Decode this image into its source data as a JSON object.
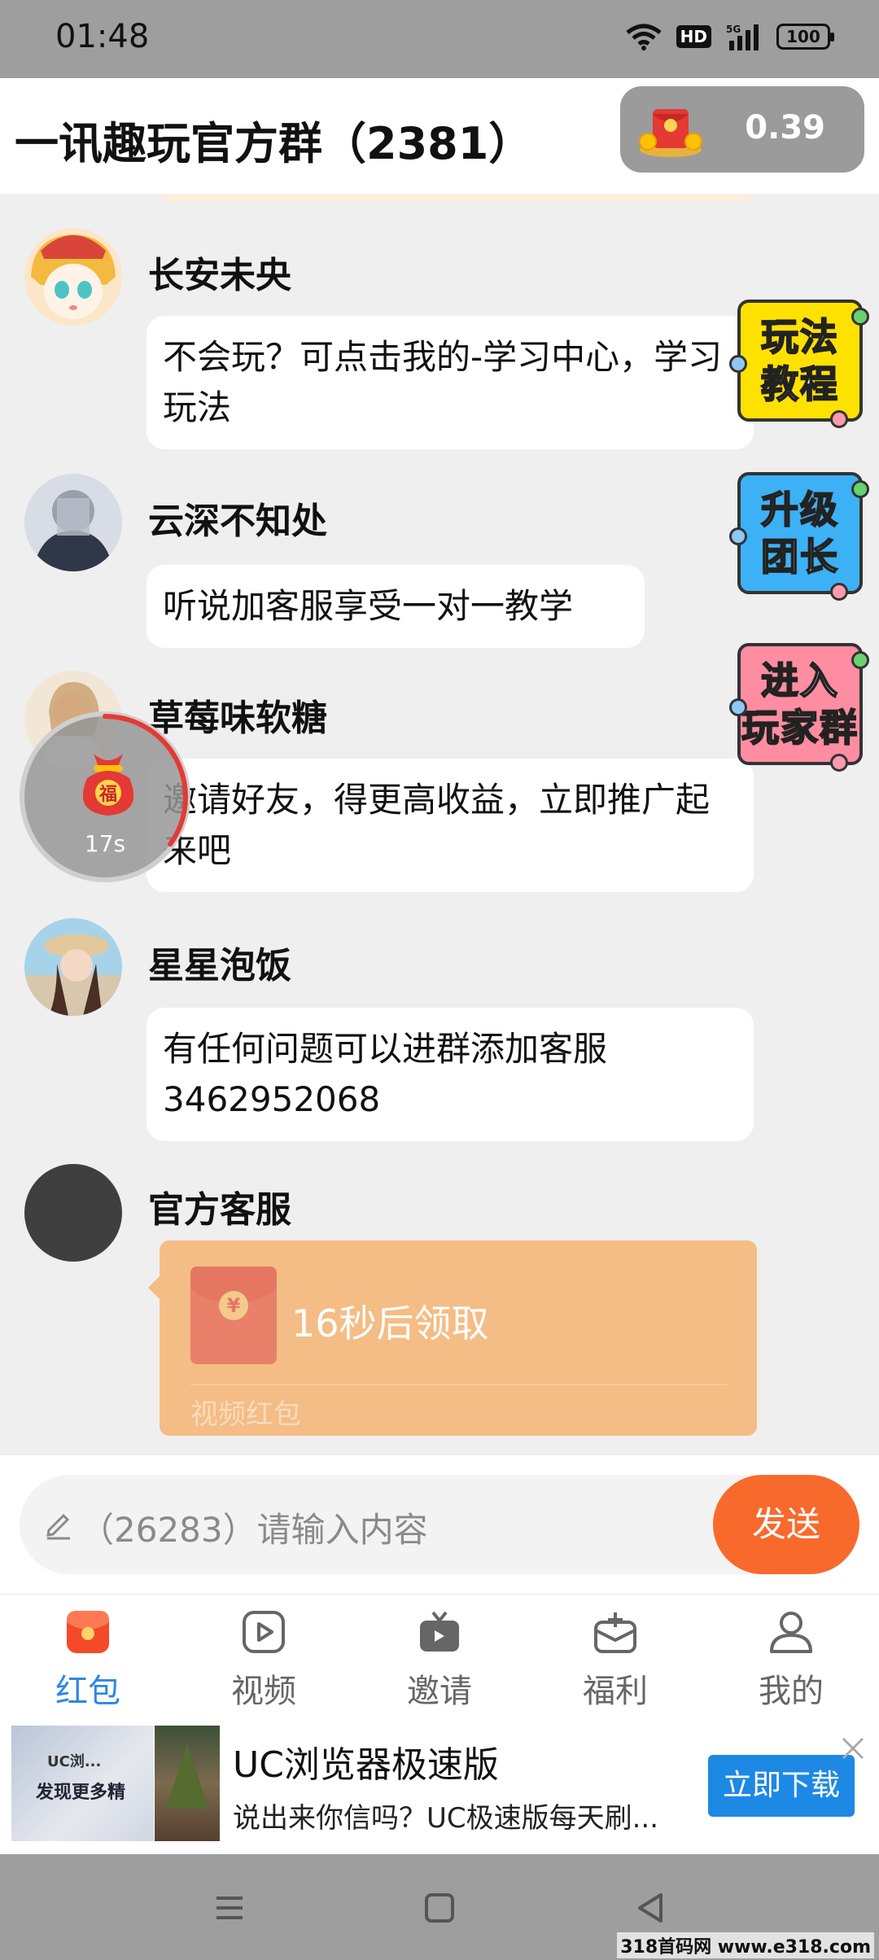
{
  "status_bar": {
    "time": "01:48",
    "battery": "100",
    "network": "5G",
    "hd": "HD"
  },
  "header": {
    "title": "一讯趣玩官方群（2381）",
    "balance": "0.39"
  },
  "messages": [
    {
      "sender": "长安未央",
      "text": "不会玩？可点击我的-学习中心，学习玩法"
    },
    {
      "sender": "云深不知处",
      "text": "听说加客服享受一对一教学"
    },
    {
      "sender": "草莓味软糖",
      "text": "邀请好友，得更高收益，立即推广起来吧"
    },
    {
      "sender": "星星泡饭",
      "text": "有任何问题可以进群添加客服3462952068"
    },
    {
      "sender": "官方客服",
      "red_packet": {
        "title": "16秒后领取",
        "label": "视频红包",
        "coin": "¥"
      }
    }
  ],
  "floating_timer": {
    "text": "17s",
    "bag_text": "福",
    "progress": 0.35
  },
  "side_badges": [
    {
      "line1": "玩法",
      "line2": "教程",
      "color": "#ffe100"
    },
    {
      "line1": "升级",
      "line2": "团长",
      "color": "#3db1f5"
    },
    {
      "line1": "进入",
      "line2": "玩家群",
      "color": "#ff8da1"
    }
  ],
  "input": {
    "placeholder": "（26283）请输入内容",
    "send_label": "发送"
  },
  "nav": [
    {
      "label": "红包",
      "icon": "red-envelope-icon",
      "active": true
    },
    {
      "label": "视频",
      "icon": "video-play-icon",
      "active": false
    },
    {
      "label": "邀请",
      "icon": "tv-icon",
      "active": false
    },
    {
      "label": "福利",
      "icon": "gift-box-icon",
      "active": false
    },
    {
      "label": "我的",
      "icon": "user-icon",
      "active": false
    }
  ],
  "ad": {
    "title": "UC浏览器极速版",
    "description": "说出来你信吗？UC极速版每天刷...",
    "button": "立即下载",
    "thumb_logo": "UC浏...",
    "thumb_text": "发现更多精"
  },
  "watermark": "318首码网 www.e318.com",
  "colors": {
    "accent": "#f86a2c",
    "nav_active": "#2e86e8",
    "red_packet": "#f4bd85"
  }
}
